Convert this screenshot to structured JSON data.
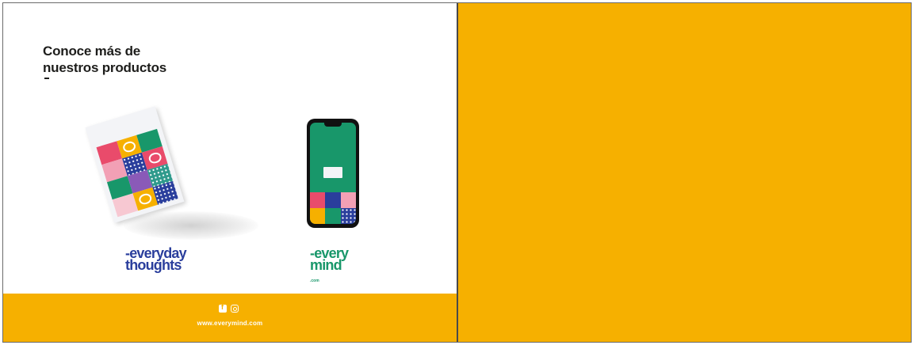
{
  "page": {
    "heading_line1": "Conoce más de",
    "heading_line2": "nuestros productos"
  },
  "products": [
    {
      "name": "everyday thoughts",
      "logo_line1": "-everyday",
      "logo_line2": "thoughts",
      "color": "#2a3e9c",
      "image": "magazine"
    },
    {
      "name": "everymind",
      "logo_line1": "-every",
      "logo_line2": "mind",
      "logo_suffix": ".com",
      "color": "#18976a",
      "image": "phone"
    }
  ],
  "footer": {
    "social_icons": [
      "facebook-icon",
      "instagram-icon"
    ],
    "url": "www.everymind.com",
    "color": "#f6b000"
  },
  "colors": {
    "accent": "#f6b000",
    "blue": "#2a3e9c",
    "green": "#18976a",
    "pink": "#e94b6b"
  }
}
